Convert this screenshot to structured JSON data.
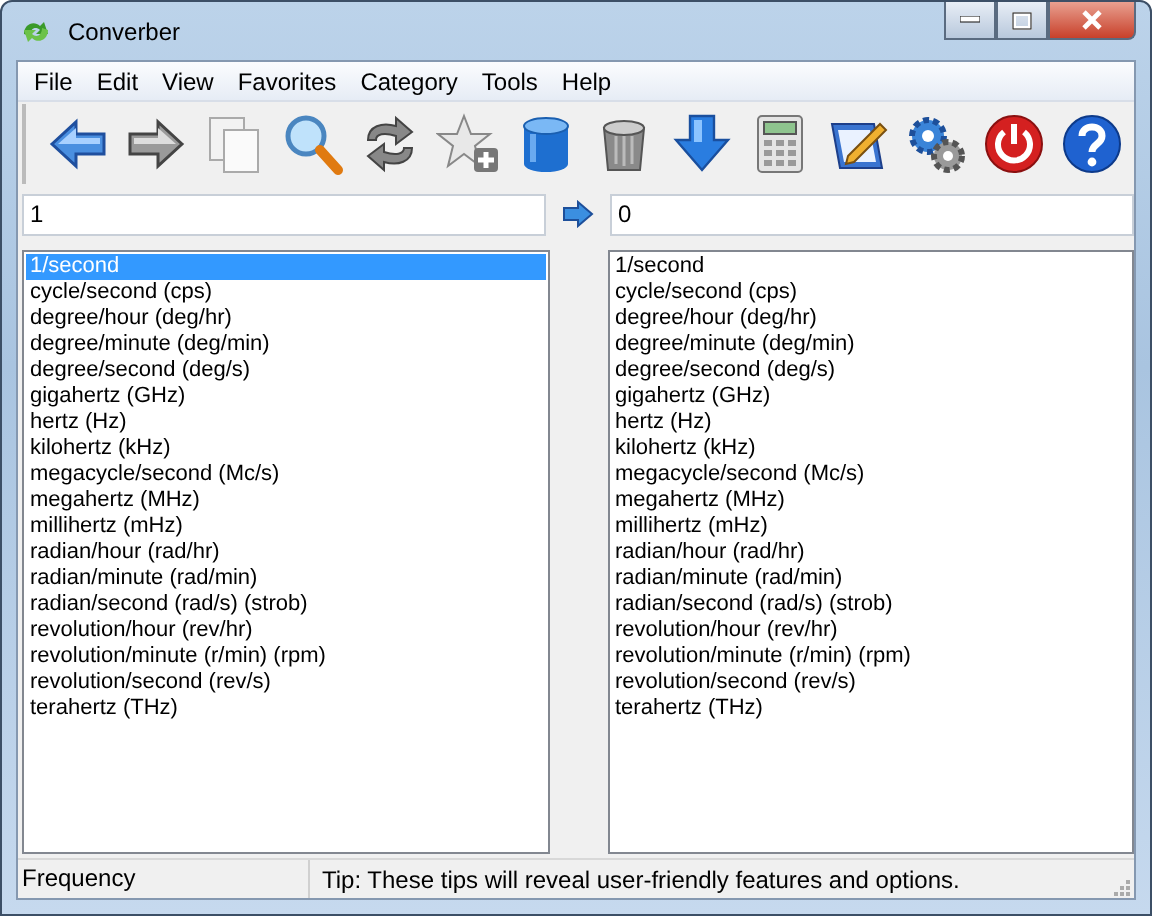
{
  "window": {
    "title": "Converber"
  },
  "menu": [
    {
      "label": "File"
    },
    {
      "label": "Edit"
    },
    {
      "label": "View"
    },
    {
      "label": "Favorites"
    },
    {
      "label": "Category"
    },
    {
      "label": "Tools"
    },
    {
      "label": "Help"
    }
  ],
  "input": {
    "value": "1"
  },
  "output": {
    "value": "0"
  },
  "from_units": [
    {
      "label": "1/second",
      "selected": true
    },
    {
      "label": "cycle/second (cps)",
      "selected": false
    },
    {
      "label": "degree/hour (deg/hr)",
      "selected": false
    },
    {
      "label": "degree/minute (deg/min)",
      "selected": false
    },
    {
      "label": "degree/second (deg/s)",
      "selected": false
    },
    {
      "label": "gigahertz (GHz)",
      "selected": false
    },
    {
      "label": "hertz (Hz)",
      "selected": false
    },
    {
      "label": "kilohertz (kHz)",
      "selected": false
    },
    {
      "label": "megacycle/second (Mc/s)",
      "selected": false
    },
    {
      "label": "megahertz (MHz)",
      "selected": false
    },
    {
      "label": "millihertz (mHz)",
      "selected": false
    },
    {
      "label": "radian/hour (rad/hr)",
      "selected": false
    },
    {
      "label": "radian/minute (rad/min)",
      "selected": false
    },
    {
      "label": "radian/second (rad/s) (strob)",
      "selected": false
    },
    {
      "label": "revolution/hour (rev/hr)",
      "selected": false
    },
    {
      "label": "revolution/minute (r/min) (rpm)",
      "selected": false
    },
    {
      "label": "revolution/second (rev/s)",
      "selected": false
    },
    {
      "label": "terahertz (THz)",
      "selected": false
    }
  ],
  "to_units": [
    {
      "label": "1/second",
      "selected": false
    },
    {
      "label": "cycle/second (cps)",
      "selected": false
    },
    {
      "label": "degree/hour (deg/hr)",
      "selected": false
    },
    {
      "label": "degree/minute (deg/min)",
      "selected": false
    },
    {
      "label": "degree/second (deg/s)",
      "selected": false
    },
    {
      "label": "gigahertz (GHz)",
      "selected": false
    },
    {
      "label": "hertz (Hz)",
      "selected": false
    },
    {
      "label": "kilohertz (kHz)",
      "selected": false
    },
    {
      "label": "megacycle/second (Mc/s)",
      "selected": false
    },
    {
      "label": "megahertz (MHz)",
      "selected": false
    },
    {
      "label": "millihertz (mHz)",
      "selected": false
    },
    {
      "label": "radian/hour (rad/hr)",
      "selected": false
    },
    {
      "label": "radian/minute (rad/min)",
      "selected": false
    },
    {
      "label": "radian/second (rad/s) (strob)",
      "selected": false
    },
    {
      "label": "revolution/hour (rev/hr)",
      "selected": false
    },
    {
      "label": "revolution/minute (r/min) (rpm)",
      "selected": false
    },
    {
      "label": "revolution/second (rev/s)",
      "selected": false
    },
    {
      "label": "terahertz (THz)",
      "selected": false
    }
  ],
  "status_bar": {
    "category": "Frequency",
    "tip": "Tip: These tips will reveal user-friendly features and options."
  }
}
